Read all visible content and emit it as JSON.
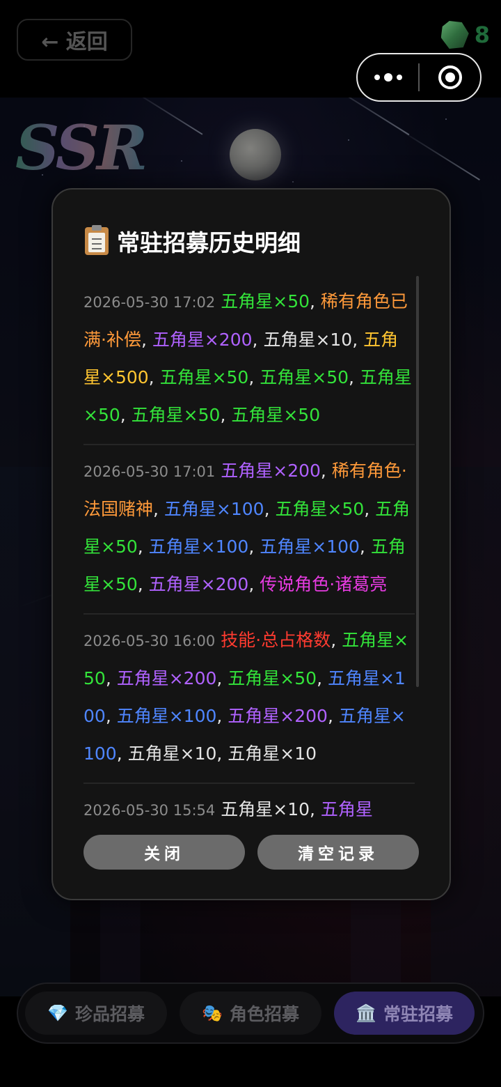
{
  "header": {
    "back_label": "← 返回",
    "gem_count": "8"
  },
  "background": {
    "logo_text": "SSR"
  },
  "modal": {
    "title": "常驻招募历史明细",
    "title_icon": "clipboard-icon",
    "entries": [
      {
        "time": "2026-05-30 17:02",
        "items": [
          {
            "text": "五角星×50",
            "color": "green"
          },
          {
            "text": "稀有角色已满·补偿",
            "color": "orange"
          },
          {
            "text": "五角星×200",
            "color": "purple"
          },
          {
            "text": "五角星×10",
            "color": "white"
          },
          {
            "text": "五角星×500",
            "color": "yellow"
          },
          {
            "text": "五角星×50",
            "color": "green"
          },
          {
            "text": "五角星×50",
            "color": "green"
          },
          {
            "text": "五角星×50",
            "color": "green"
          },
          {
            "text": "五角星×50",
            "color": "green"
          },
          {
            "text": "五角星×50",
            "color": "green"
          }
        ]
      },
      {
        "time": "2026-05-30 17:01",
        "items": [
          {
            "text": "五角星×200",
            "color": "purple"
          },
          {
            "text": "稀有角色·法国赌神",
            "color": "orange"
          },
          {
            "text": "五角星×100",
            "color": "blue"
          },
          {
            "text": "五角星×50",
            "color": "green"
          },
          {
            "text": "五角星×50",
            "color": "green"
          },
          {
            "text": "五角星×100",
            "color": "blue"
          },
          {
            "text": "五角星×100",
            "color": "blue"
          },
          {
            "text": "五角星×50",
            "color": "green"
          },
          {
            "text": "五角星×200",
            "color": "purple"
          },
          {
            "text": "传说角色·诸葛亮",
            "color": "magenta"
          }
        ]
      },
      {
        "time": "2026-05-30 16:00",
        "items": [
          {
            "text": "技能·总占格数",
            "color": "red"
          },
          {
            "text": "五角星×50",
            "color": "green"
          },
          {
            "text": "五角星×200",
            "color": "purple"
          },
          {
            "text": "五角星×50",
            "color": "green"
          },
          {
            "text": "五角星×100",
            "color": "blue"
          },
          {
            "text": "五角星×100",
            "color": "blue"
          },
          {
            "text": "五角星×200",
            "color": "purple"
          },
          {
            "text": "五角星×100",
            "color": "blue"
          },
          {
            "text": "五角星×10",
            "color": "white"
          },
          {
            "text": "五角星×10",
            "color": "white"
          }
        ]
      },
      {
        "time": "2026-05-30 15:54",
        "items": [
          {
            "text": "五角星×10",
            "color": "white"
          },
          {
            "text": "五角星",
            "color": "purple"
          }
        ]
      }
    ],
    "separator": ", ",
    "buttons": {
      "close": "关闭",
      "clear": "清空记录"
    }
  },
  "tabs": [
    {
      "label": "珍品招募",
      "icon": "💎",
      "active": false
    },
    {
      "label": "角色招募",
      "icon": "🎭",
      "active": false
    },
    {
      "label": "常驻招募",
      "icon": "🏛️",
      "active": true
    }
  ],
  "colors": {
    "green": "#33e33a",
    "orange": "#ff9a3a",
    "purple": "#b062ff",
    "white": "#e4e4e4",
    "yellow": "#ffc531",
    "blue": "#4f86ff",
    "magenta": "#e63be0",
    "red": "#ff3b30",
    "active_tab": "#2d2460"
  }
}
